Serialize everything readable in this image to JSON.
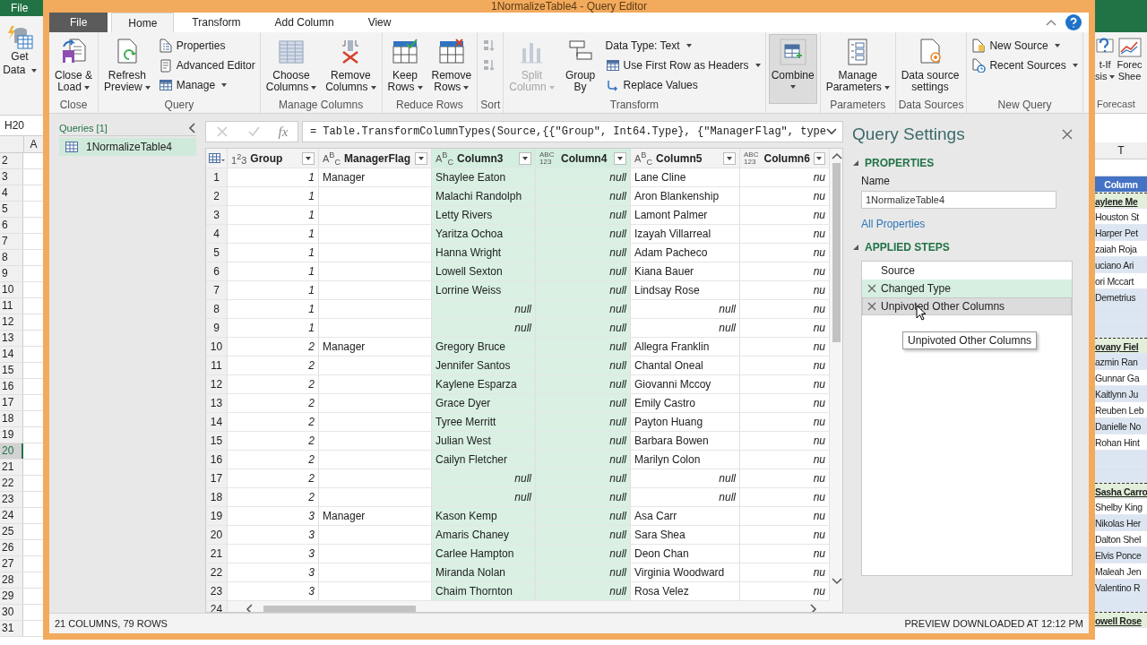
{
  "excel": {
    "file_tab": "File",
    "get_data": [
      "Get",
      "Data"
    ],
    "name_box": "H20",
    "column": "A",
    "row_numbers": [
      {
        "n": "2",
        "selected": false
      },
      {
        "n": "3",
        "selected": false
      },
      {
        "n": "4",
        "selected": false
      },
      {
        "n": "5",
        "selected": false
      },
      {
        "n": "6",
        "selected": false
      },
      {
        "n": "7",
        "selected": false
      },
      {
        "n": "8",
        "selected": false
      },
      {
        "n": "9",
        "selected": false
      },
      {
        "n": "10",
        "selected": false
      },
      {
        "n": "11",
        "selected": false
      },
      {
        "n": "12",
        "selected": false
      },
      {
        "n": "13",
        "selected": false
      },
      {
        "n": "14",
        "selected": false
      },
      {
        "n": "15",
        "selected": false
      },
      {
        "n": "16",
        "selected": false
      },
      {
        "n": "17",
        "selected": false
      },
      {
        "n": "18",
        "selected": false
      },
      {
        "n": "19",
        "selected": false
      },
      {
        "n": "20",
        "selected": true
      },
      {
        "n": "21",
        "selected": false
      },
      {
        "n": "22",
        "selected": false
      },
      {
        "n": "23",
        "selected": false
      },
      {
        "n": "24",
        "selected": false
      },
      {
        "n": "25",
        "selected": false
      },
      {
        "n": "26",
        "selected": false
      },
      {
        "n": "27",
        "selected": false
      },
      {
        "n": "28",
        "selected": false
      },
      {
        "n": "29",
        "selected": false
      },
      {
        "n": "30",
        "selected": false
      },
      {
        "n": "31",
        "selected": false
      }
    ],
    "right_ribbon": {
      "what_if": [
        "t-If",
        "sis"
      ],
      "forecast_sheet": [
        "Forec",
        "Shee"
      ],
      "group": "Forecast"
    },
    "right_column": "T",
    "right_cells": [
      {
        "kind": "header",
        "text": "Column"
      },
      {
        "kind": "group",
        "text": "aylene Me"
      },
      {
        "kind": "name",
        "text": "Houston St"
      },
      {
        "kind": "name",
        "text": "Harper Pet"
      },
      {
        "kind": "name",
        "text": "zaiah Roja"
      },
      {
        "kind": "name",
        "text": "uciano Ari"
      },
      {
        "kind": "name",
        "text": "ori Mccart"
      },
      {
        "kind": "name",
        "text": "Demetrius"
      },
      {
        "kind": "blank"
      },
      {
        "kind": "blank"
      },
      {
        "kind": "group",
        "text": "ovany Fiel"
      },
      {
        "kind": "name",
        "text": "azmin Ran"
      },
      {
        "kind": "name",
        "text": "Gunnar Ga"
      },
      {
        "kind": "name",
        "text": "Kaitlynn Ju"
      },
      {
        "kind": "name",
        "text": "Reuben Leb"
      },
      {
        "kind": "name",
        "text": "Danielle No"
      },
      {
        "kind": "name",
        "text": "Rohan Hint"
      },
      {
        "kind": "blank"
      },
      {
        "kind": "blank"
      },
      {
        "kind": "group",
        "text": "Sasha Carro"
      },
      {
        "kind": "name",
        "text": "Shelby King"
      },
      {
        "kind": "name",
        "text": "Nikolas Her"
      },
      {
        "kind": "name",
        "text": "Dalton Shel"
      },
      {
        "kind": "name",
        "text": "Elvis Ponce"
      },
      {
        "kind": "name",
        "text": "Maleah Jen"
      },
      {
        "kind": "name",
        "text": "Valentino R"
      },
      {
        "kind": "blank"
      },
      {
        "kind": "group",
        "text": "owell Rose"
      }
    ]
  },
  "window": {
    "title": "1NormalizeTable4 - Query Editor"
  },
  "tabs": [
    {
      "label": "File",
      "kind": "file",
      "selected": false
    },
    {
      "label": "Home",
      "kind": "tab",
      "selected": true
    },
    {
      "label": "Transform",
      "kind": "tab",
      "selected": false
    },
    {
      "label": "Add Column",
      "kind": "tab",
      "selected": false
    },
    {
      "label": "View",
      "kind": "tab",
      "selected": false
    }
  ],
  "ribbon": {
    "groups": [
      {
        "label": "Close",
        "items": [
          {
            "kind": "large",
            "lines": [
              "Close &",
              "Load"
            ],
            "dropdown": true,
            "disabled": false,
            "pressed": false
          }
        ]
      },
      {
        "label": "Query",
        "items": [
          {
            "kind": "large",
            "lines": [
              "Refresh",
              "Preview"
            ],
            "dropdown": true,
            "disabled": false,
            "pressed": false
          },
          {
            "kind": "small",
            "label": "Properties",
            "dropdown": false,
            "disabled": false,
            "pressed": false
          },
          {
            "kind": "small",
            "label": "Advanced Editor",
            "dropdown": false,
            "disabled": false,
            "pressed": false
          },
          {
            "kind": "small",
            "label": "Manage",
            "dropdown": true,
            "disabled": false,
            "pressed": false
          }
        ]
      },
      {
        "label": "Manage Columns",
        "items": [
          {
            "kind": "large",
            "lines": [
              "Choose",
              "Columns"
            ],
            "dropdown": true,
            "disabled": false,
            "pressed": false
          },
          {
            "kind": "large",
            "lines": [
              "Remove",
              "Columns"
            ],
            "dropdown": true,
            "disabled": false,
            "pressed": false
          }
        ]
      },
      {
        "label": "Reduce Rows",
        "items": [
          {
            "kind": "large",
            "lines": [
              "Keep",
              "Rows"
            ],
            "dropdown": true,
            "disabled": false,
            "pressed": false
          },
          {
            "kind": "large",
            "lines": [
              "Remove",
              "Rows"
            ],
            "dropdown": true,
            "disabled": false,
            "pressed": false
          }
        ]
      },
      {
        "label": "Sort",
        "items": [
          {
            "kind": "small",
            "dropdown": false,
            "disabled": true,
            "pressed": false
          },
          {
            "kind": "small",
            "dropdown": false,
            "disabled": true,
            "pressed": false
          }
        ]
      },
      {
        "label": "Transform",
        "items": [
          {
            "kind": "large",
            "lines": [
              "Split",
              "Column"
            ],
            "dropdown": true,
            "disabled": true,
            "pressed": false
          },
          {
            "kind": "large",
            "lines": [
              "Group",
              "By"
            ],
            "dropdown": false,
            "disabled": false,
            "pressed": false
          },
          {
            "kind": "small",
            "label": "Data Type: Text",
            "dropdown": true,
            "disabled": false,
            "pressed": false
          },
          {
            "kind": "small",
            "label": "Use First Row as Headers",
            "dropdown": true,
            "disabled": false,
            "pressed": false
          },
          {
            "kind": "small",
            "label": "Replace Values",
            "dropdown": false,
            "disabled": false,
            "pressed": false
          }
        ]
      },
      {
        "items": [
          {
            "kind": "large",
            "lines": [
              "Combine"
            ],
            "dropdown": true,
            "disabled": false,
            "pressed": true
          }
        ]
      },
      {
        "label": "Parameters",
        "items": [
          {
            "kind": "large",
            "lines": [
              "Manage",
              "Parameters"
            ],
            "dropdown": true,
            "disabled": false,
            "pressed": false
          }
        ]
      },
      {
        "label": "Data Sources",
        "items": [
          {
            "kind": "large",
            "lines": [
              "Data source",
              "settings"
            ],
            "dropdown": false,
            "disabled": false,
            "pressed": false
          }
        ]
      },
      {
        "label": "New Query",
        "items": [
          {
            "kind": "small",
            "label": "New Source",
            "dropdown": true,
            "disabled": false,
            "pressed": false
          },
          {
            "kind": "small",
            "label": "Recent Sources",
            "dropdown": true,
            "disabled": false,
            "pressed": false
          }
        ]
      }
    ]
  },
  "queries": {
    "title": "Queries [1]",
    "items": [
      {
        "label": "1NormalizeTable4",
        "selected": true
      }
    ]
  },
  "formula": {
    "fx": "fx",
    "text": "= Table.TransformColumnTypes(Source,{{\"Group\", Int64.Type}, {\"ManagerFlag\", type"
  },
  "table": {
    "columns": [
      {
        "name": "Group",
        "kind": "number",
        "type_label": "1$^{2}$3",
        "selected": false
      },
      {
        "name": "ManagerFlag",
        "kind": "text",
        "type_label": "A$^{B}$$_{C}$",
        "selected": false
      },
      {
        "name": "Column3",
        "kind": "text",
        "type_label": "A$^{B}$$_{C}$",
        "selected": true
      },
      {
        "name": "Column4",
        "kind": "any",
        "type_label": "ABC 123",
        "selected": true
      },
      {
        "name": "Column5",
        "kind": "text",
        "type_label": "A$^{B}$$_{C}$",
        "selected": false
      },
      {
        "name": "Column6",
        "kind": "any",
        "type_label": "ABC 123",
        "selected": false
      }
    ],
    "rows": [
      {
        "num": "1",
        "cells": [
          "1",
          "Manager",
          "Shaylee Eaton",
          "null",
          "Lane Cline",
          "nu"
        ],
        "null_cells": [
          false,
          false,
          false,
          true,
          false,
          true
        ]
      },
      {
        "num": "2",
        "cells": [
          "1",
          null,
          "Malachi Randolph",
          "null",
          "Aron Blankenship",
          "nu"
        ],
        "null_cells": [
          false,
          false,
          false,
          true,
          false,
          true
        ]
      },
      {
        "num": "3",
        "cells": [
          "1",
          null,
          "Letty Rivers",
          "null",
          "Lamont Palmer",
          "nu"
        ],
        "null_cells": [
          false,
          false,
          false,
          true,
          false,
          true
        ]
      },
      {
        "num": "4",
        "cells": [
          "1",
          null,
          "Yaritza Ochoa",
          "null",
          "Izayah Villarreal",
          "nu"
        ],
        "null_cells": [
          false,
          false,
          false,
          true,
          false,
          true
        ]
      },
      {
        "num": "5",
        "cells": [
          "1",
          null,
          "Hanna Wright",
          "null",
          "Adam Pacheco",
          "nu"
        ],
        "null_cells": [
          false,
          false,
          false,
          true,
          false,
          true
        ]
      },
      {
        "num": "6",
        "cells": [
          "1",
          null,
          "Lowell Sexton",
          "null",
          "Kiana Bauer",
          "nu"
        ],
        "null_cells": [
          false,
          false,
          false,
          true,
          false,
          true
        ]
      },
      {
        "num": "7",
        "cells": [
          "1",
          null,
          "Lorrine Weiss",
          "null",
          "Lindsay Rose",
          "nu"
        ],
        "null_cells": [
          false,
          false,
          false,
          true,
          false,
          true
        ]
      },
      {
        "num": "8",
        "cells": [
          "1",
          null,
          "null",
          "null",
          "null",
          "nu"
        ],
        "null_cells": [
          false,
          false,
          true,
          true,
          true,
          true
        ]
      },
      {
        "num": "9",
        "cells": [
          "1",
          null,
          "null",
          "null",
          "null",
          "nu"
        ],
        "null_cells": [
          false,
          false,
          true,
          true,
          true,
          true
        ]
      },
      {
        "num": "10",
        "cells": [
          "2",
          "Manager",
          "Gregory Bruce",
          "null",
          "Allegra Franklin",
          "nu"
        ],
        "null_cells": [
          false,
          false,
          false,
          true,
          false,
          true
        ]
      },
      {
        "num": "11",
        "cells": [
          "2",
          null,
          "Jennifer Santos",
          "null",
          "Chantal Oneal",
          "nu"
        ],
        "null_cells": [
          false,
          false,
          false,
          true,
          false,
          true
        ]
      },
      {
        "num": "12",
        "cells": [
          "2",
          null,
          "Kaylene Esparza",
          "null",
          "Giovanni Mccoy",
          "nu"
        ],
        "null_cells": [
          false,
          false,
          false,
          true,
          false,
          true
        ]
      },
      {
        "num": "13",
        "cells": [
          "2",
          null,
          "Grace Dyer",
          "null",
          "Emily Castro",
          "nu"
        ],
        "null_cells": [
          false,
          false,
          false,
          true,
          false,
          true
        ]
      },
      {
        "num": "14",
        "cells": [
          "2",
          null,
          "Tyree Merritt",
          "null",
          "Payton Huang",
          "nu"
        ],
        "null_cells": [
          false,
          false,
          false,
          true,
          false,
          true
        ]
      },
      {
        "num": "15",
        "cells": [
          "2",
          null,
          "Julian West",
          "null",
          "Barbara Bowen",
          "nu"
        ],
        "null_cells": [
          false,
          false,
          false,
          true,
          false,
          true
        ]
      },
      {
        "num": "16",
        "cells": [
          "2",
          null,
          "Cailyn Fletcher",
          "null",
          "Marilyn Colon",
          "nu"
        ],
        "null_cells": [
          false,
          false,
          false,
          true,
          false,
          true
        ]
      },
      {
        "num": "17",
        "cells": [
          "2",
          null,
          "null",
          "null",
          "null",
          "nu"
        ],
        "null_cells": [
          false,
          false,
          true,
          true,
          true,
          true
        ]
      },
      {
        "num": "18",
        "cells": [
          "2",
          null,
          "null",
          "null",
          "null",
          "nu"
        ],
        "null_cells": [
          false,
          false,
          true,
          true,
          true,
          true
        ]
      },
      {
        "num": "19",
        "cells": [
          "3",
          "Manager",
          "Kason Kemp",
          "null",
          "Asa Carr",
          "nu"
        ],
        "null_cells": [
          false,
          false,
          false,
          true,
          false,
          true
        ]
      },
      {
        "num": "20",
        "cells": [
          "3",
          null,
          "Amaris Chaney",
          "null",
          "Sara Shea",
          "nu"
        ],
        "null_cells": [
          false,
          false,
          false,
          true,
          false,
          true
        ]
      },
      {
        "num": "21",
        "cells": [
          "3",
          null,
          "Carlee Hampton",
          "null",
          "Deon Chan",
          "nu"
        ],
        "null_cells": [
          false,
          false,
          false,
          true,
          false,
          true
        ]
      },
      {
        "num": "22",
        "cells": [
          "3",
          null,
          "Miranda Nolan",
          "null",
          "Virginia Woodward",
          "nu"
        ],
        "null_cells": [
          false,
          false,
          false,
          true,
          false,
          true
        ]
      },
      {
        "num": "23",
        "cells": [
          "3",
          null,
          "Chaim Thornton",
          "null",
          "Rosa Velez",
          "nu"
        ],
        "null_cells": [
          false,
          false,
          false,
          true,
          false,
          true
        ]
      }
    ],
    "last_row_number": "24"
  },
  "settings": {
    "title": "Query Settings",
    "properties": {
      "heading": "PROPERTIES",
      "name_label": "Name",
      "name_value": "1NormalizeTable4",
      "link": "All Properties"
    },
    "steps_heading": "APPLIED STEPS",
    "steps": [
      {
        "label": "Source",
        "removable": false,
        "selected": false,
        "hovered": false
      },
      {
        "label": "Changed Type",
        "removable": true,
        "selected": true,
        "hovered": false
      },
      {
        "label": "Unpivoted Other Columns",
        "removable": true,
        "selected": false,
        "hovered": true
      }
    ],
    "tooltip": "Unpivoted Other Columns"
  },
  "status_bar": {
    "left": "21 COLUMNS, 79 ROWS",
    "right": "PREVIEW DOWNLOADED AT 12:12 PM"
  }
}
